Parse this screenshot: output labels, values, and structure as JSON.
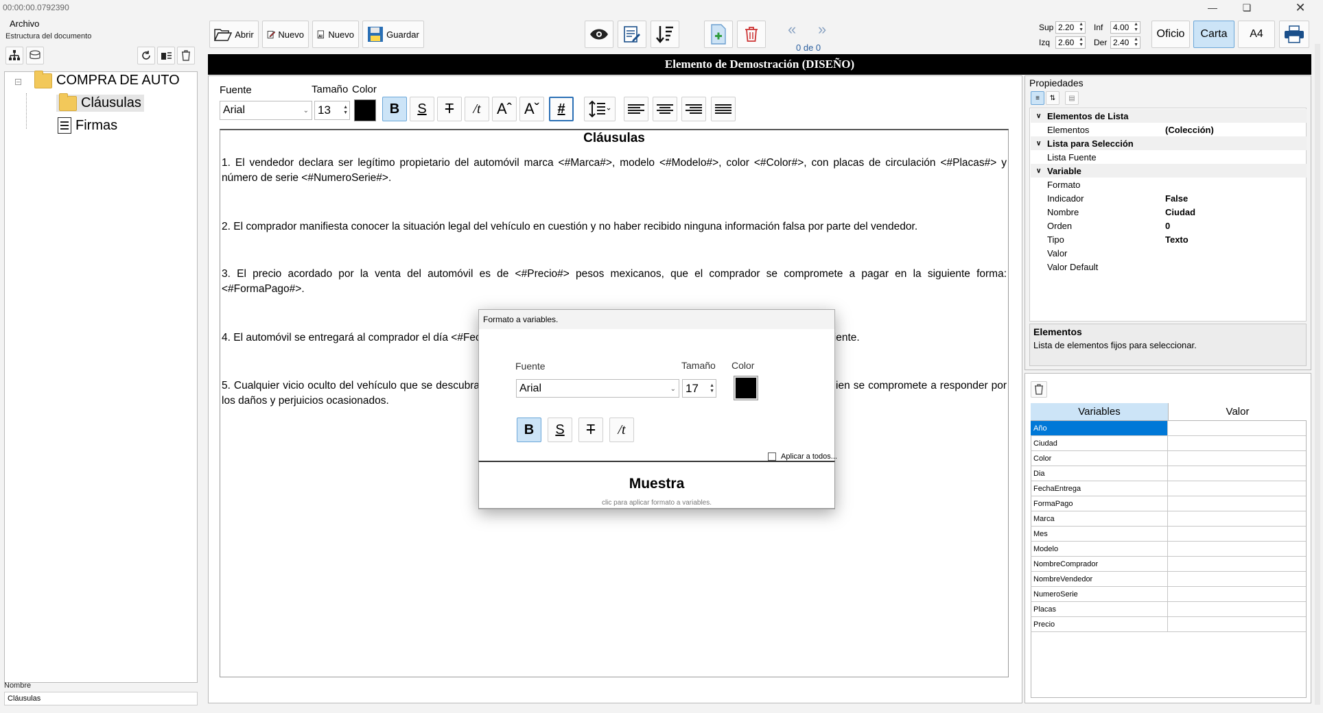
{
  "window": {
    "timer": "00:00:00.0792390"
  },
  "menu": {
    "archivo": "Archivo"
  },
  "doc_structure": {
    "label": "Estructura del documento",
    "root": "COMPRA DE AUTO",
    "children": [
      "Cláusulas",
      "Firmas"
    ],
    "name_label": "Nombre",
    "name_value": "Cláusulas"
  },
  "toolbar": {
    "abrir": "Abrir",
    "nuevo": "Nuevo",
    "nuevo_ai": "Nuevo",
    "guardar": "Guardar",
    "page_counter": "0 de 0",
    "margins": {
      "sup_label": "Sup",
      "sup": "2.20",
      "inf_label": "Inf",
      "inf": "4.00",
      "izq_label": "Izq",
      "izq": "2.60",
      "der_label": "Der",
      "der": "2.40"
    },
    "page_sizes": [
      "Oficio",
      "Carta",
      "A4"
    ],
    "selected_page_size": "Carta"
  },
  "editor": {
    "header": "Elemento de Demostración (DISEÑO)",
    "fuente_label": "Fuente",
    "tamano_label": "Tamaño",
    "color_label": "Color",
    "font": "Arial",
    "size": "13",
    "title": "Cláusulas",
    "paragraphs": [
      "1. El vendedor declara ser legítimo propietario del automóvil marca <#Marca#>, modelo <#Modelo#>, color <#Color#>, con placas de circulación <#Placas#> y número de serie <#NumeroSerie#>.",
      "2. El comprador manifiesta conocer la situación legal del vehículo en cuestión y no haber recibido ninguna información falsa por parte del vendedor.",
      "3. El precio acordado por la venta del automóvil es de <#Precio#> pesos mexicanos, que el comprador se compromete a pagar en la siguiente forma: <#FormaPago#>.",
      "4. El automóvil se entregará al comprador el día <#FechaEntrega#> en el lugar acordado, junto con la documentación correspondiente.",
      "5. Cualquier vicio oculto del vehículo que se descubra después de la entrega y que haya sido del conocimiento del vendedor, quien se compromete a responder por los daños y perjuicios ocasionados."
    ]
  },
  "properties": {
    "title": "Propiedades",
    "rows": [
      {
        "k": "Elementos de Lista",
        "v": "",
        "cat": true
      },
      {
        "k": "Elementos",
        "v": "(Colección)",
        "cat": false
      },
      {
        "k": "Lista para Selección",
        "v": "",
        "cat": true
      },
      {
        "k": "Lista Fuente",
        "v": "",
        "cat": false
      },
      {
        "k": "Variable",
        "v": "",
        "cat": true
      },
      {
        "k": "Formato",
        "v": "",
        "cat": false
      },
      {
        "k": "Indicador",
        "v": "False",
        "cat": false
      },
      {
        "k": "Nombre",
        "v": "Ciudad",
        "cat": false
      },
      {
        "k": "Orden",
        "v": "0",
        "cat": false
      },
      {
        "k": "Tipo",
        "v": "Texto",
        "cat": false
      },
      {
        "k": "Valor",
        "v": "",
        "cat": false
      },
      {
        "k": "Valor Default",
        "v": "",
        "cat": false
      }
    ],
    "help_title": "Elementos",
    "help_text": "Lista de elementos fijos para seleccionar."
  },
  "variables": {
    "col_variables": "Variables",
    "col_valor": "Valor",
    "items": [
      "Año",
      "Ciudad",
      "Color",
      "Dia",
      "FechaEntrega",
      "FormaPago",
      "Marca",
      "Mes",
      "Modelo",
      "NombreComprador",
      "NombreVendedor",
      "NumeroSerie",
      "Placas",
      "Precio"
    ],
    "selected": "Año"
  },
  "dialog": {
    "title": "Formato a variables.",
    "fuente_label": "Fuente",
    "tamano_label": "Tamaño",
    "color_label": "Color",
    "font": "Arial",
    "size": "17",
    "apply_all": "Aplicar a todos...",
    "sample": "Muestra",
    "sample_hint": "clic para aplicar formato a variables."
  }
}
